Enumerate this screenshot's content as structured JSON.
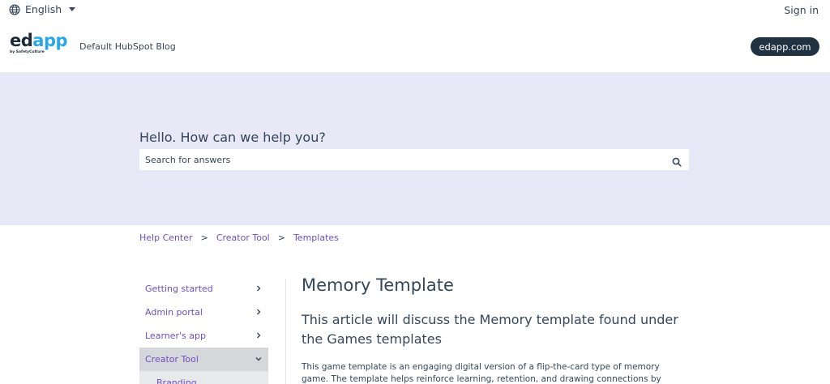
{
  "utility": {
    "language": "English",
    "sign_in": "Sign in"
  },
  "header": {
    "logo_ed": "ed",
    "logo_app": "app",
    "logo_sub": "by SafetyCulture",
    "blog_title": "Default HubSpot Blog",
    "site_button": "edapp.com"
  },
  "hero": {
    "title": "Hello. How can we help you?",
    "search_placeholder": "Search for answers"
  },
  "breadcrumb": {
    "items": [
      "Help Center",
      "Creator Tool",
      "Templates"
    ],
    "separator": ">"
  },
  "sidebar": {
    "items": [
      {
        "label": "Getting started"
      },
      {
        "label": "Admin portal"
      },
      {
        "label": "Learner's app"
      },
      {
        "label": "Creator Tool"
      }
    ],
    "sub_item": "Branding"
  },
  "article": {
    "title": "Memory Template",
    "subtitle": "This article will discuss the Memory template found under the Games templates",
    "body": "This game template is an engaging digital version of a flip-the-card type of memory game. The template helps reinforce learning, retention, and drawing connections by remembering"
  },
  "colors": {
    "accent_link": "#6f4fc2",
    "hero_bg": "#e8e8f6",
    "dark_button": "#213343",
    "text": "#33475b",
    "logo_blue": "#2aa7e6"
  },
  "icons": {
    "language": "globe-icon",
    "search": "search-icon",
    "chevron_right": "chevron-right-icon",
    "chevron_down": "chevron-down-icon"
  }
}
